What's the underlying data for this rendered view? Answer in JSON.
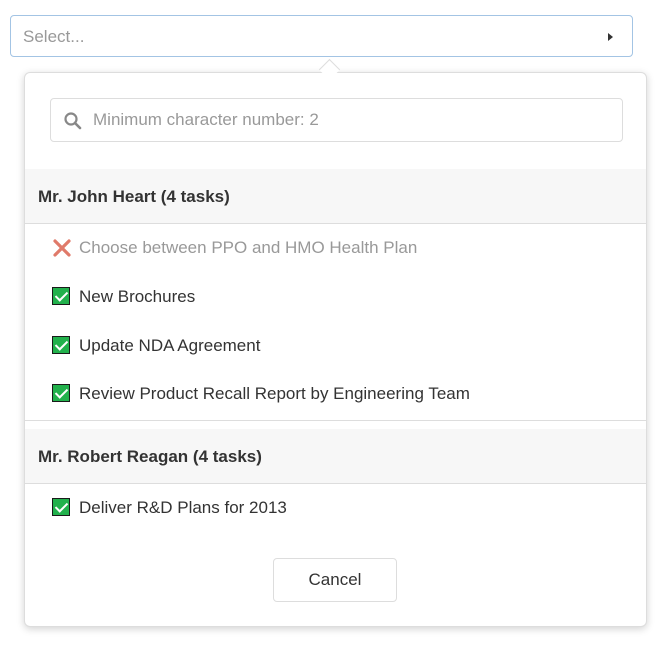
{
  "select": {
    "placeholder": "Select..."
  },
  "search": {
    "placeholder": "Minimum character number: 2"
  },
  "groups": [
    {
      "header": "Mr. John Heart (4 tasks)",
      "items": [
        {
          "label": "Choose between PPO and HMO Health Plan",
          "status": "cancelled",
          "icon": "x-mark-icon"
        },
        {
          "label": "New Brochures",
          "status": "completed",
          "icon": "checkbox-checked-icon"
        },
        {
          "label": "Update NDA Agreement",
          "status": "completed",
          "icon": "checkbox-checked-icon"
        },
        {
          "label": "Review Product Recall Report by Engineering Team",
          "status": "completed",
          "icon": "checkbox-checked-icon"
        }
      ]
    },
    {
      "header": "Mr. Robert Reagan (4 tasks)",
      "items": [
        {
          "label": "Deliver R&D Plans for 2013",
          "status": "completed",
          "icon": "checkbox-checked-icon"
        }
      ]
    }
  ],
  "buttons": {
    "cancel_label": "Cancel"
  },
  "colors": {
    "accent_border": "#a3c4e4",
    "check_green": "#22b14c",
    "cross_red": "#e07a6a",
    "header_bg": "#f7f7f7"
  }
}
